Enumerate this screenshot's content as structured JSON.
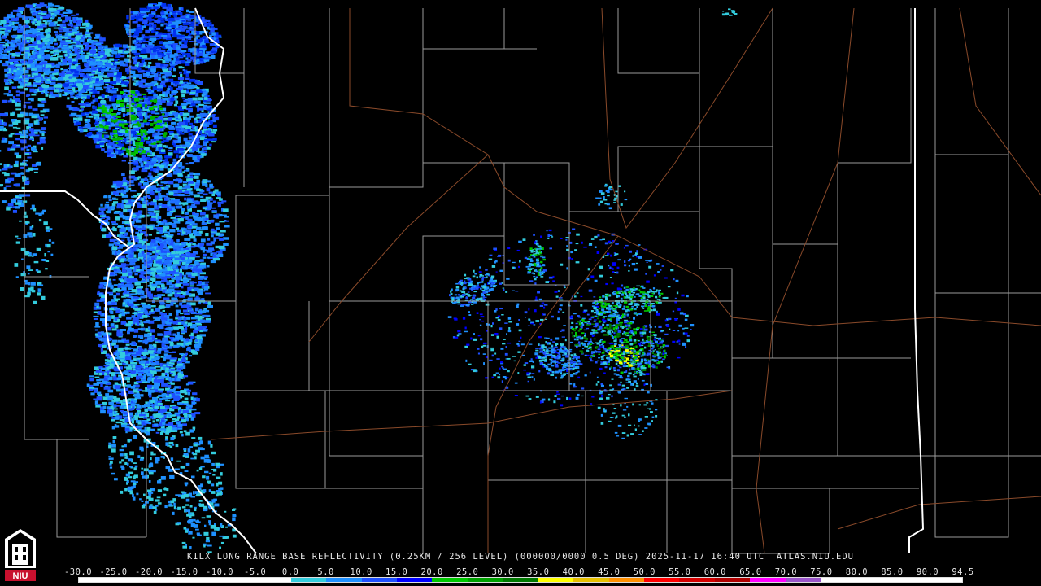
{
  "product": {
    "caption": "KILX LONG RANGE BASE REFLECTIVITY (0.25KM / 256 LEVEL) (000000/0000 0.5 DEG) 2025-11-17 16:40 UTC  ATLAS.NIU.EDU",
    "site": "KILX",
    "elevation": "0.5 DEG",
    "timestamp": "2025-11-17 16:40 UTC",
    "source": "ATLAS.NIU.EDU"
  },
  "logo": {
    "text": "NIU",
    "icon": "niu-tower-logo-icon"
  },
  "colorscale": {
    "labels": [
      "-30.0",
      "-25.0",
      "-20.0",
      "-15.0",
      "-10.0",
      "-5.0",
      "0.0",
      "5.0",
      "10.0",
      "15.0",
      "20.0",
      "25.0",
      "30.0",
      "35.0",
      "40.0",
      "45.0",
      "50.0",
      "55.0",
      "60.0",
      "65.0",
      "70.0",
      "75.0",
      "80.0",
      "85.0",
      "90.0",
      "94.5"
    ],
    "colors": [
      "#ffffff",
      "#ffffff",
      "#ffffff",
      "#ffffff",
      "#ffffff",
      "#ffffff",
      "#33ccdd",
      "#1e90ff",
      "#1e50ff",
      "#0000ff",
      "#00c800",
      "#00a000",
      "#007800",
      "#ffff00",
      "#e6c000",
      "#ff9000",
      "#ff0000",
      "#d40000",
      "#b00000",
      "#ff00ff",
      "#9955c9",
      "#ffffff",
      "#ffffff",
      "#ffffff",
      "#ffffff"
    ]
  },
  "map_colors": {
    "background": "#000000",
    "county_lines": "#9a9a9a",
    "state_lines": "#ffffff",
    "highways": "#8a4a2a"
  }
}
